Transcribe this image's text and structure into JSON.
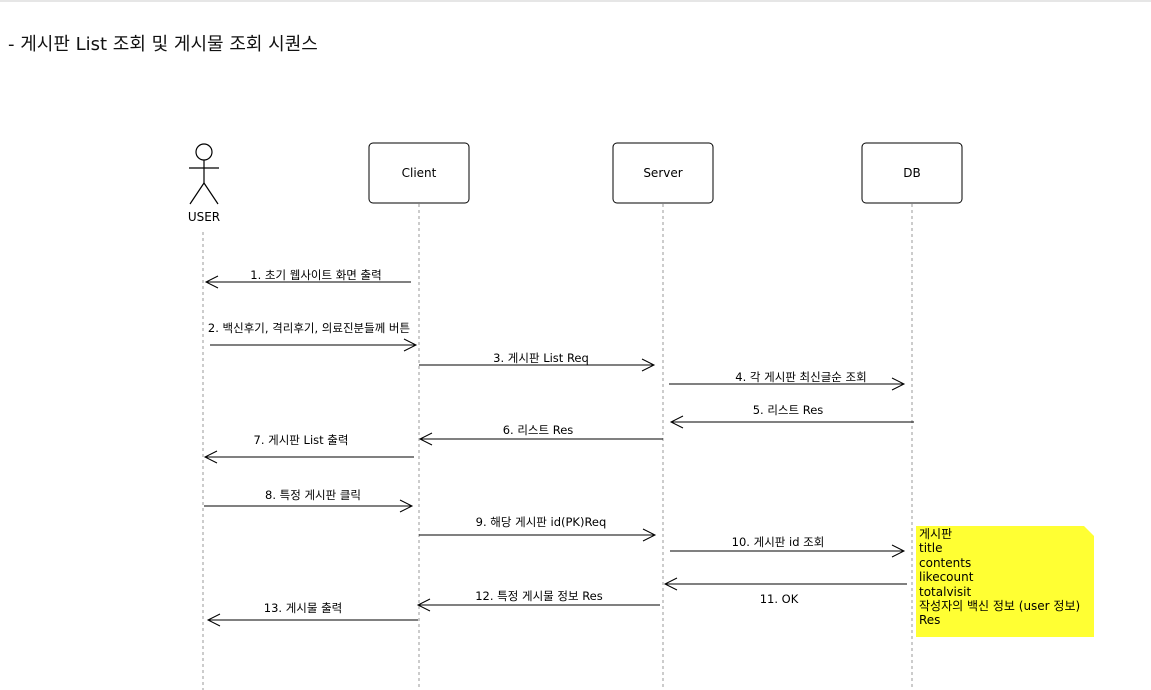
{
  "page": {
    "heading": "- 게시판 List 조회 및 게시물 조회 시퀀스"
  },
  "participants": {
    "user": "USER",
    "client": "Client",
    "server": "Server",
    "db": "DB"
  },
  "messages": [
    {
      "id": "m1",
      "label": "1. 초기 웹사이트 화면 출력"
    },
    {
      "id": "m2",
      "label": "2. 백신후기, 격리후기, 의료진분들께 버튼"
    },
    {
      "id": "m3",
      "label": "3. 게시판 List Req"
    },
    {
      "id": "m4",
      "label": "4. 각 게시판 최신글순 조회"
    },
    {
      "id": "m5",
      "label": "5. 리스트 Res"
    },
    {
      "id": "m6",
      "label": "6. 리스트 Res"
    },
    {
      "id": "m7",
      "label": "7. 게시판 List 출력"
    },
    {
      "id": "m8",
      "label": "8. 특정 게시판 클릭"
    },
    {
      "id": "m9",
      "label": "9. 해당 게시판 id(PK)Req"
    },
    {
      "id": "m10",
      "label": "10. 게시판 id 조회"
    },
    {
      "id": "m11",
      "label": "11. OK"
    },
    {
      "id": "m12",
      "label": "12. 특정 게시물 정보 Res"
    },
    {
      "id": "m13",
      "label": "13. 게시물 출력"
    }
  ],
  "note": {
    "lines": [
      "게시판",
      "title",
      "contents",
      "likecount",
      "totalvisit",
      "작성자의 백신 정보 (user 정보)",
      "Res"
    ]
  }
}
